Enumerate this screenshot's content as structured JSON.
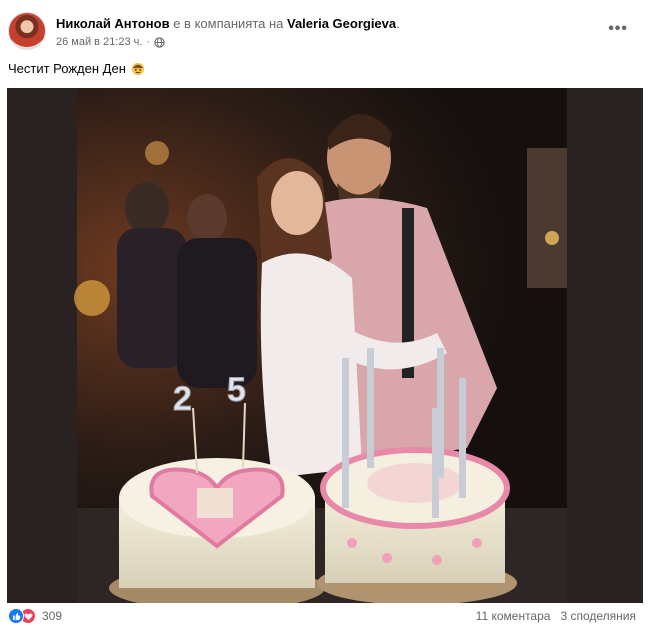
{
  "post": {
    "author": "Николай Антонов",
    "with_text": " е в компанията на ",
    "tagged": "Valeria Georgieva",
    "tagged_suffix": ".",
    "timestamp": "26 май в 21:23 ч.",
    "meta_separator": " · ",
    "caption": "Честит Рожден Ден",
    "candle_digits": [
      "2",
      "5"
    ]
  },
  "footer": {
    "reaction_count": "309",
    "comments": "11 коментара",
    "shares": "3 споделяния"
  },
  "icons": {
    "more": "more-options-icon",
    "privacy": "globe-icon",
    "like": "like-reaction-icon",
    "love": "love-reaction-icon",
    "emoji": "emoji-icon"
  },
  "colors": {
    "accent": "#1877f2",
    "love": "#f33e58",
    "secondary_text": "#65676b"
  }
}
